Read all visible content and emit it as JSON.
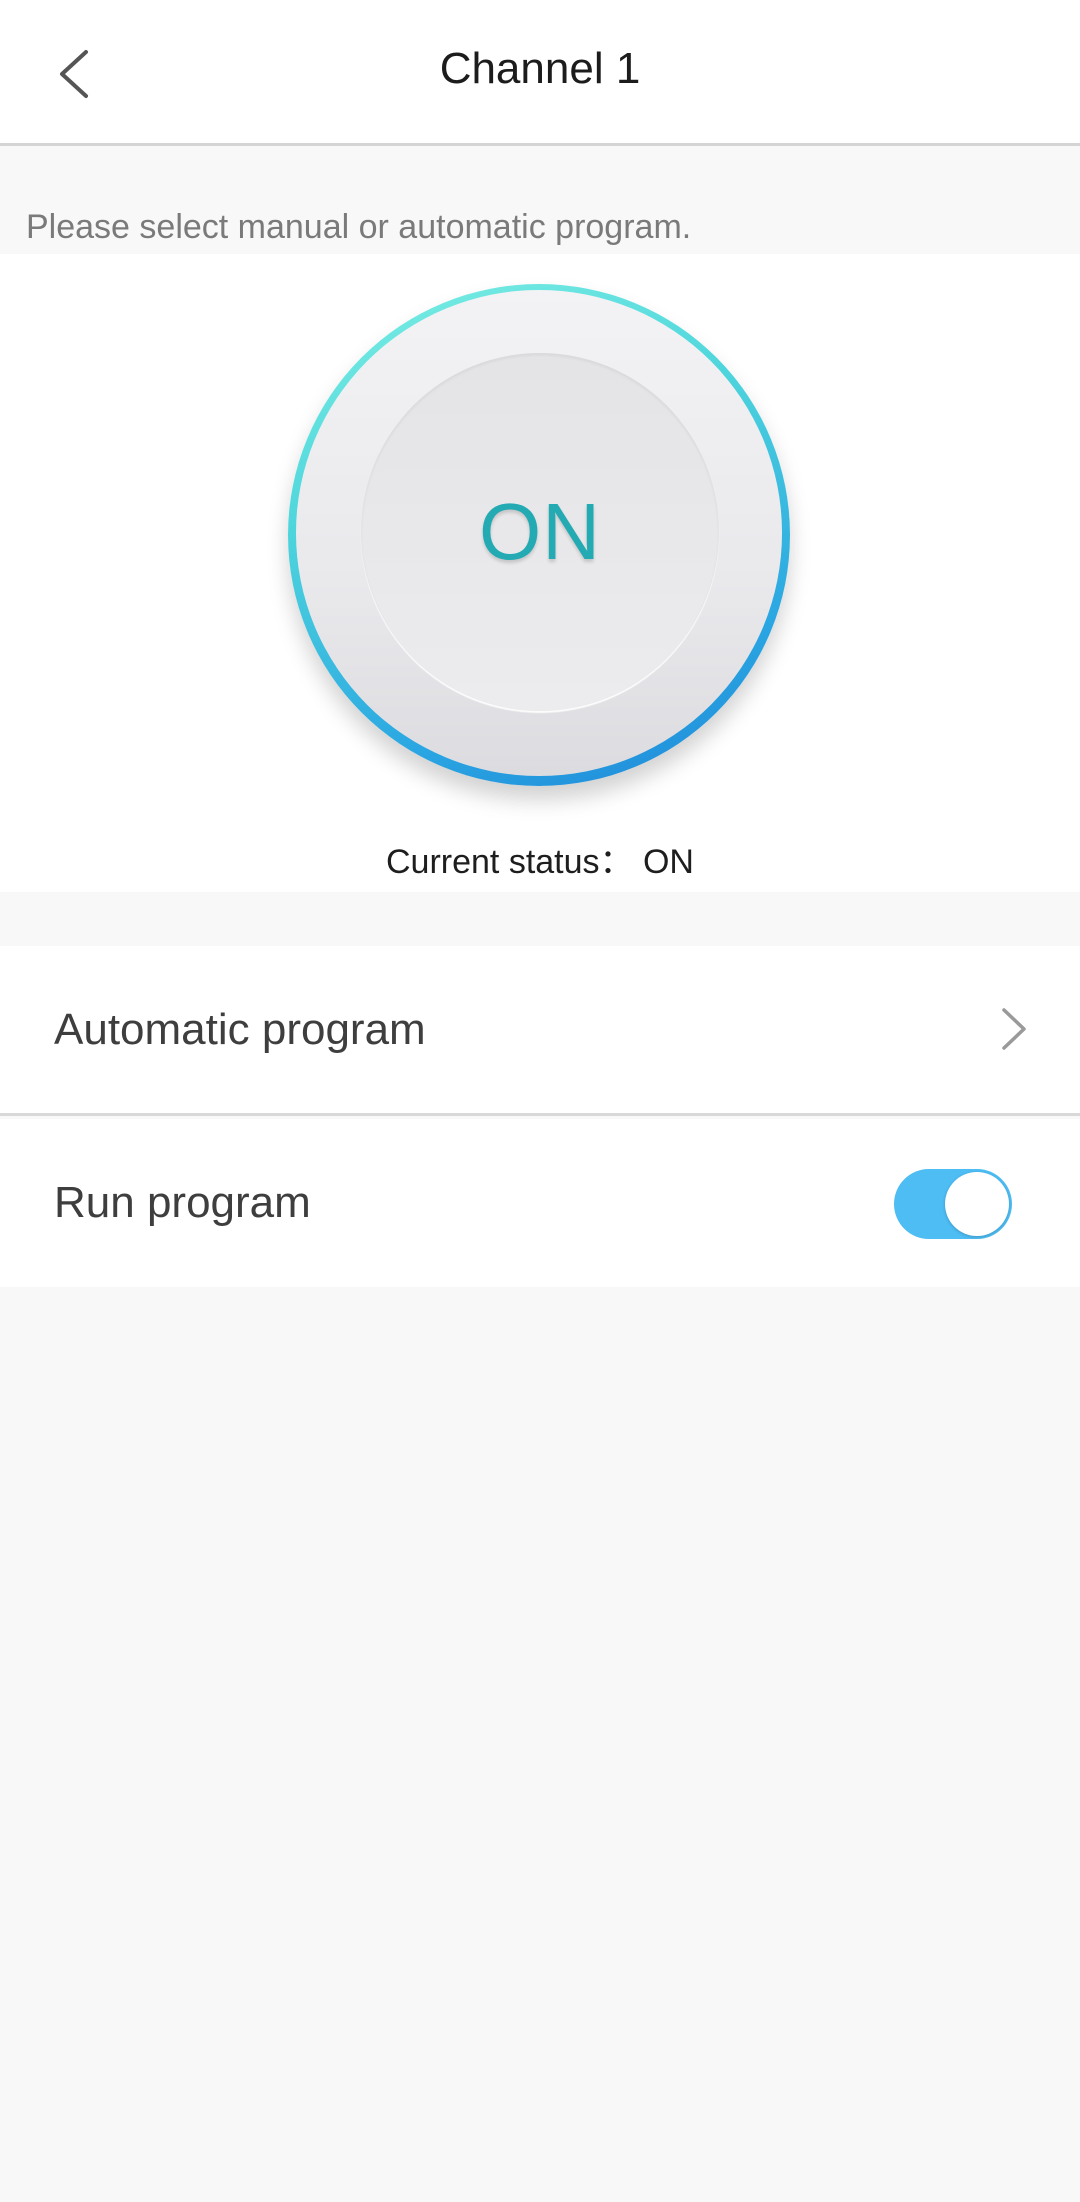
{
  "header": {
    "back_icon": "chevron-left-icon",
    "title": "Channel 1"
  },
  "hint": "Please select manual or automatic program.",
  "dial": {
    "label": "ON",
    "accent_color": "#24aab2",
    "ring_colors": [
      "#7ff0e4",
      "#1e86d8"
    ]
  },
  "status": {
    "text": "Current status： ON"
  },
  "rows": {
    "automatic_program": {
      "label": "Automatic program",
      "icon": "chevron-right-icon"
    },
    "run_program": {
      "label": "Run program",
      "toggle_on": true,
      "toggle_color": "#4dbdf4"
    }
  }
}
